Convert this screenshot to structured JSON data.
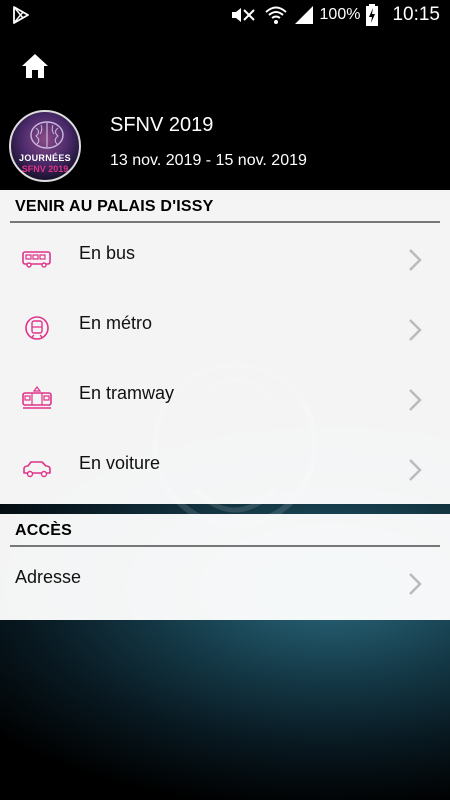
{
  "status_bar": {
    "battery_percent": "100%",
    "time": "10:15",
    "icons": [
      "play-store-icon",
      "mute-icon",
      "wifi-icon",
      "signal-icon",
      "battery-charging-icon"
    ]
  },
  "header": {
    "home_icon": "home-icon",
    "logo": {
      "line1": "JOURNÉES",
      "line2": "SFNV 2019"
    },
    "title": "SFNV 2019",
    "dates": "13 nov. 2019 - 15 nov. 2019"
  },
  "sections": [
    {
      "title": "VENIR AU PALAIS D'ISSY",
      "items": [
        {
          "label": "En bus",
          "icon": "bus-icon"
        },
        {
          "label": "En métro",
          "icon": "metro-icon"
        },
        {
          "label": "En tramway",
          "icon": "tram-icon"
        },
        {
          "label": "En voiture",
          "icon": "car-icon"
        }
      ]
    },
    {
      "title": "ACCÈS",
      "items": [
        {
          "label": "Adresse"
        }
      ]
    }
  ],
  "colors": {
    "accent": "#e0338a",
    "background": "#000000",
    "panel": "#ffffff"
  }
}
